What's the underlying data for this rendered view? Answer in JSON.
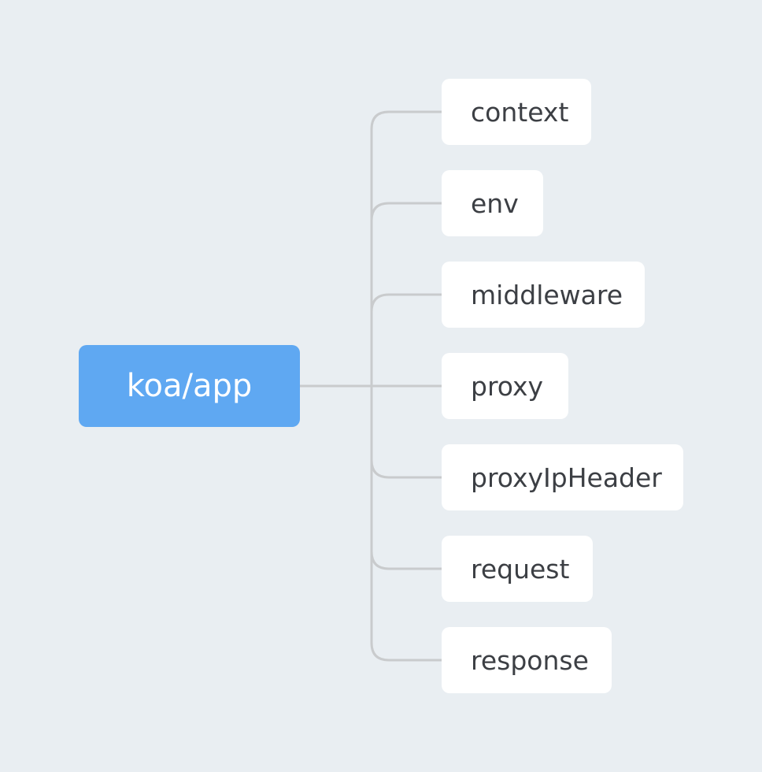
{
  "root": {
    "label": "koa/app"
  },
  "children": [
    {
      "label": "context"
    },
    {
      "label": "env"
    },
    {
      "label": "middleware"
    },
    {
      "label": "proxy"
    },
    {
      "label": "proxyIpHeader"
    },
    {
      "label": "request"
    },
    {
      "label": "response"
    }
  ],
  "colors": {
    "background": "#e9eef2",
    "root_fill": "#5fa8f2",
    "root_text": "#ffffff",
    "child_fill": "#ffffff",
    "child_text": "#3c3f44",
    "connector": "#c9cbcd"
  }
}
